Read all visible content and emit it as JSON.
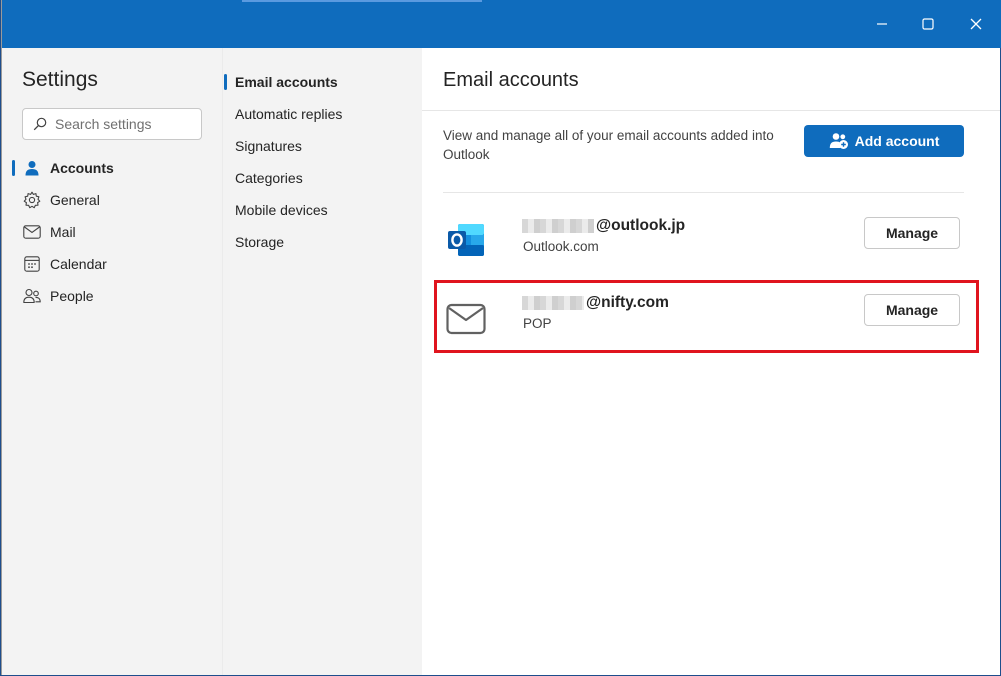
{
  "window": {
    "controls": {
      "minimize_icon": "minimize-icon",
      "maximize_icon": "maximize-icon",
      "close_icon": "close-icon"
    }
  },
  "settings": {
    "title": "Settings",
    "search": {
      "placeholder": "Search settings"
    },
    "nav": [
      {
        "label": "Accounts",
        "icon": "person-icon",
        "active": true
      },
      {
        "label": "General",
        "icon": "gear-icon"
      },
      {
        "label": "Mail",
        "icon": "mail-icon"
      },
      {
        "label": "Calendar",
        "icon": "calendar-icon"
      },
      {
        "label": "People",
        "icon": "people-icon"
      }
    ]
  },
  "accounts_menu": {
    "items": [
      {
        "label": "Email accounts",
        "active": true
      },
      {
        "label": "Automatic replies"
      },
      {
        "label": "Signatures"
      },
      {
        "label": "Categories"
      },
      {
        "label": "Mobile devices"
      },
      {
        "label": "Storage"
      }
    ]
  },
  "panel": {
    "title": "Email accounts",
    "description": "View and manage all of your email accounts added into Outlook",
    "add_account_label": "Add account",
    "accounts": [
      {
        "email": "@outlook.jp",
        "type": "Outlook.com",
        "icon": "outlook-logo-icon",
        "manage_label": "Manage"
      },
      {
        "email": "@nifty.com",
        "type": "POP",
        "icon": "envelope-icon",
        "manage_label": "Manage",
        "highlighted": true
      }
    ]
  },
  "colors": {
    "accent": "#0f6cbd",
    "highlight": "#e0141e"
  }
}
